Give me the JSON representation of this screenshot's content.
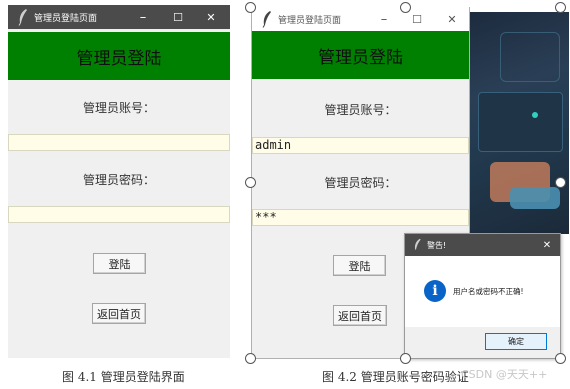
{
  "figure1": {
    "window_title": "管理员登陆页面",
    "header": "管理员登陆",
    "account_label": "管理员账号：",
    "password_label": "管理员密码：",
    "account_value": "",
    "password_value": "",
    "login_button": "登陆",
    "back_button": "返回首页",
    "caption": "图 4.1 管理员登陆界面"
  },
  "figure2": {
    "window_title": "管理员登陆页面",
    "header": "管理员登陆",
    "account_label": "管理员账号：",
    "password_label": "管理员密码：",
    "account_value": "admin",
    "password_value": "***",
    "login_button": "登陆",
    "back_button": "返回首页",
    "caption": "图 4.2 管理员账号密码验证"
  },
  "alert": {
    "title": "警告!",
    "message": "用户名或密码不正确!",
    "ok_button": "确定",
    "icon": "info-icon"
  },
  "window_controls": {
    "minimize": "–",
    "maximize": "☐",
    "close": "✕"
  },
  "watermark": "CSDN @天天++",
  "colors": {
    "header_green": "#008000",
    "entry_bg": "#fffde8",
    "titlebar_dark": "#4b4b4b",
    "info_blue": "#0a64c8"
  }
}
